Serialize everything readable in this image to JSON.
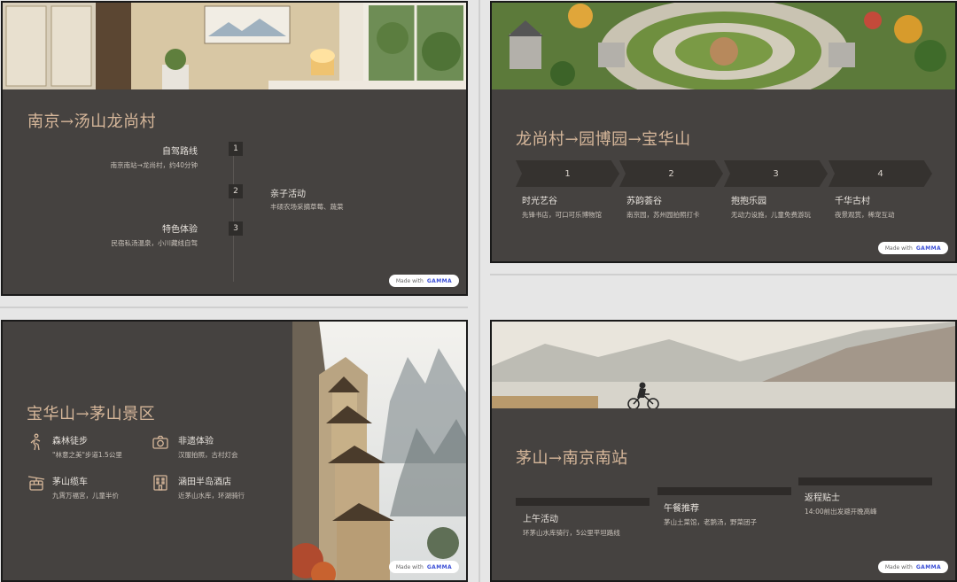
{
  "made_with": {
    "prefix": "Made with",
    "brand": "GAMMA"
  },
  "slide1": {
    "title": "南京→汤山龙尚村",
    "steps": [
      {
        "num": "1",
        "head": "自驾路线",
        "sub": "南京南站→龙尚村，约40分钟"
      },
      {
        "num": "2",
        "head": "亲子活动",
        "sub": "丰硕农场采摘草莓、蔬菜"
      },
      {
        "num": "3",
        "head": "特色体验",
        "sub": "民宿私汤温泉，小川藏线自驾"
      }
    ]
  },
  "slide2": {
    "title": "龙尚村→园博园→宝华山",
    "steps": [
      {
        "num": "1",
        "head": "时光艺谷",
        "sub": "先锋书店，可口可乐博物馆"
      },
      {
        "num": "2",
        "head": "苏韵荟谷",
        "sub": "南京园，苏州园拍照打卡"
      },
      {
        "num": "3",
        "head": "抱抱乐园",
        "sub": "无动力设施，儿童免费游玩"
      },
      {
        "num": "4",
        "head": "千华古村",
        "sub": "夜景观赏，稀宠互动"
      }
    ]
  },
  "slide3": {
    "title": "宝华山→茅山景区",
    "items": [
      {
        "icon": "hiking-icon",
        "head": "森林徒步",
        "sub": "\"林意之美\"步道1.5公里"
      },
      {
        "icon": "camera-icon",
        "head": "非遗体验",
        "sub": "汉服拍照，古村灯会"
      },
      {
        "icon": "cable-car-icon",
        "head": "茅山缆车",
        "sub": "九霄万福宫，儿童半价"
      },
      {
        "icon": "hotel-icon",
        "head": "涵田半岛酒店",
        "sub": "近茅山水库，环湖骑行"
      }
    ]
  },
  "slide4": {
    "title": "茅山→南京南站",
    "items": [
      {
        "head": "上午活动",
        "sub": "环茅山水库骑行，5公里平坦路线"
      },
      {
        "head": "午餐推荐",
        "sub": "茅山土菜馆，老鹅汤，野菜团子"
      },
      {
        "head": "返程贴士",
        "sub": "14:00前出发避开晚高峰"
      }
    ]
  },
  "colors": {
    "slide_bg": "#454240",
    "title": "#d6b79a",
    "accent_brand": "#3b4fd6"
  }
}
